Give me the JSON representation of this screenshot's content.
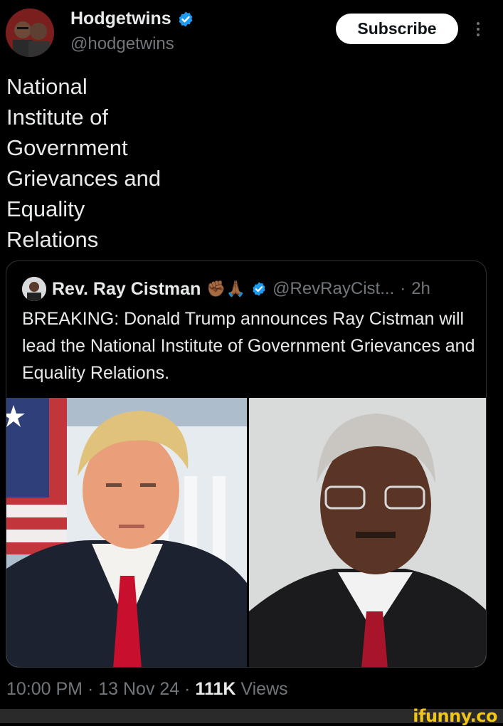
{
  "author": {
    "name": "Hodgetwins",
    "handle": "@hodgetwins",
    "avatar_icon": "profile-photo-icon",
    "verified_icon": "verified-badge-icon",
    "verified_color": "#1d9bf0"
  },
  "actions": {
    "subscribe_label": "Subscribe",
    "more_icon": "more-vertical-icon"
  },
  "post": {
    "text": "National\nInstitute of\nGovernment\nGrievances and\nEquality\nRelations"
  },
  "quoted_post": {
    "author_name": "Rev. Ray Cistman",
    "emojis": "✊🏾🙏🏾",
    "handle": "@RevRayCist...",
    "separator": " · ",
    "time": "2h",
    "text": "BREAKING: Donald Trump announces Ray Cistman will lead the National Institute of Government Grievances and Equality Relations.",
    "images": [
      {
        "icon": "portrait-photo-left"
      },
      {
        "icon": "portrait-photo-right"
      }
    ]
  },
  "meta": {
    "time": "10:00 PM",
    "date": "13 Nov 24",
    "views_count": "111K",
    "views_label": "Views",
    "separator": " · "
  },
  "watermark": {
    "text": "ifunny.co",
    "color": "#f0c419"
  }
}
